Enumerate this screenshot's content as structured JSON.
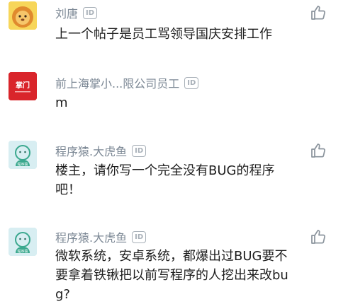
{
  "comments": [
    {
      "name": "刘唐",
      "badge": "ID",
      "text": "上一个帖子是员工骂领导国庆安排工作",
      "avatar": "lion-avatar"
    },
    {
      "name": "前上海掌小...限公司员工",
      "badge": "ID",
      "text": "m",
      "avatar": "company-logo-avatar",
      "avatar_text": "掌门"
    },
    {
      "name": "程序猿.大虎鱼",
      "badge": "ID",
      "text": "楼主，请你写一个完全没有BUG的程序吧！",
      "avatar": "monkey-avatar",
      "avatar_text": "程序猿"
    },
    {
      "name": "程序猿.大虎鱼",
      "badge": "ID",
      "text": "微软系统，安卓系统，都爆出过BUG要不要拿着铁锹把以前写程序的人挖出来改bug?",
      "avatar": "monkey-avatar",
      "avatar_text": "程序猿"
    }
  ],
  "colors": {
    "name": "#7b8794",
    "text": "#1e1e1e",
    "badge": "#a8b0b8",
    "like_icon": "#8a939c"
  },
  "icons": {
    "like": "thumbs-up-icon"
  }
}
